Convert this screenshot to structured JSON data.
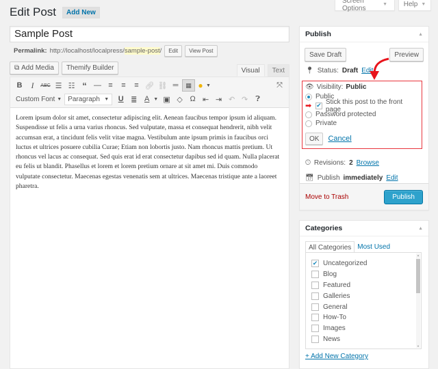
{
  "header": {
    "screen_options": "Screen Options",
    "help": "Help",
    "page_title": "Edit Post",
    "add_new": "Add New"
  },
  "post": {
    "title": "Sample Post",
    "permalink_label": "Permalink:",
    "permalink_base": "http://localhost/localpress/",
    "permalink_slug": "sample-post",
    "permalink_trail": "/",
    "edit_label": "Edit",
    "view_post_label": "View Post"
  },
  "media": {
    "add_media": "Add Media",
    "themify_builder": "Themify Builder"
  },
  "editor": {
    "tab_visual": "Visual",
    "tab_text": "Text",
    "custom_font": "Custom Font",
    "paragraph": "Paragraph",
    "toolbar_row1_icons": [
      "bold-icon",
      "italic-icon",
      "strikethrough-icon",
      "bullet-list-icon",
      "numbered-list-icon",
      "blockquote-icon",
      "horizontal-rule-icon",
      "align-left-icon",
      "align-center-icon",
      "align-right-icon",
      "link-icon",
      "unlink-icon",
      "read-more-icon",
      "toolbar-toggle-icon",
      "emoji-icon",
      "fullscreen-icon"
    ],
    "toolbar_row2_icons": [
      "underline-icon",
      "justify-icon",
      "text-color-icon",
      "paste-text-icon",
      "clear-formatting-icon",
      "special-character-icon",
      "outdent-icon",
      "indent-icon",
      "undo-icon",
      "redo-icon",
      "help-icon"
    ],
    "content": "Lorem ipsum dolor sit amet, consectetur adipiscing elit. Aenean faucibus tempor ipsum id aliquam. Suspendisse ut felis a urna varius rhoncus. Sed vulputate, massa et consequat hendrerit, nibh velit accumsan erat, a tincidunt felis velit vitae magna. Vestibulum ante ipsum primis in faucibus orci luctus et ultrices posuere cubilia Curae; Etiam non lobortis justo. Nam rhoncus mattis pretium. Ut rhoncus vel lacus ac consequat. Sed quis erat id erat consectetur dapibus sed id quam. Nulla placerat eu felis ut blandit. Phasellus et lorem et lorem pretium ornare at sit amet mi. Duis commodo vulputate consectetur. Maecenas egestas venenatis sem at ultrices. Maecenas tristique ante a laoreet pharetra."
  },
  "publish": {
    "title": "Publish",
    "save_draft": "Save Draft",
    "preview": "Preview",
    "status_label": "Status:",
    "status_value": "Draft",
    "status_edit": "Edit",
    "visibility_label": "Visibility:",
    "visibility_value": "Public",
    "options": [
      {
        "label": "Public",
        "selected": true
      },
      {
        "label": "Password protected",
        "selected": false
      },
      {
        "label": "Private",
        "selected": false
      }
    ],
    "sticky_label": "Stick this post to the front page",
    "sticky_checked": true,
    "ok": "OK",
    "cancel": "Cancel",
    "revisions_label": "Revisions:",
    "revisions_count": "2",
    "revisions_browse": "Browse",
    "publish_label": "Publish",
    "publish_when": "immediately",
    "publish_edit": "Edit",
    "move_to_trash": "Move to Trash",
    "publish_button": "Publish",
    "accent_color": "#2ea2cc",
    "highlight_color": "#e8343c"
  },
  "categories": {
    "title": "Categories",
    "tab_all": "All Categories",
    "tab_most_used": "Most Used",
    "items": [
      {
        "label": "Uncategorized",
        "checked": true
      },
      {
        "label": "Blog",
        "checked": false
      },
      {
        "label": "Featured",
        "checked": false
      },
      {
        "label": "Galleries",
        "checked": false
      },
      {
        "label": "General",
        "checked": false
      },
      {
        "label": "How-To",
        "checked": false
      },
      {
        "label": "Images",
        "checked": false
      },
      {
        "label": "News",
        "checked": false
      }
    ],
    "add_new": "+ Add New Category"
  }
}
